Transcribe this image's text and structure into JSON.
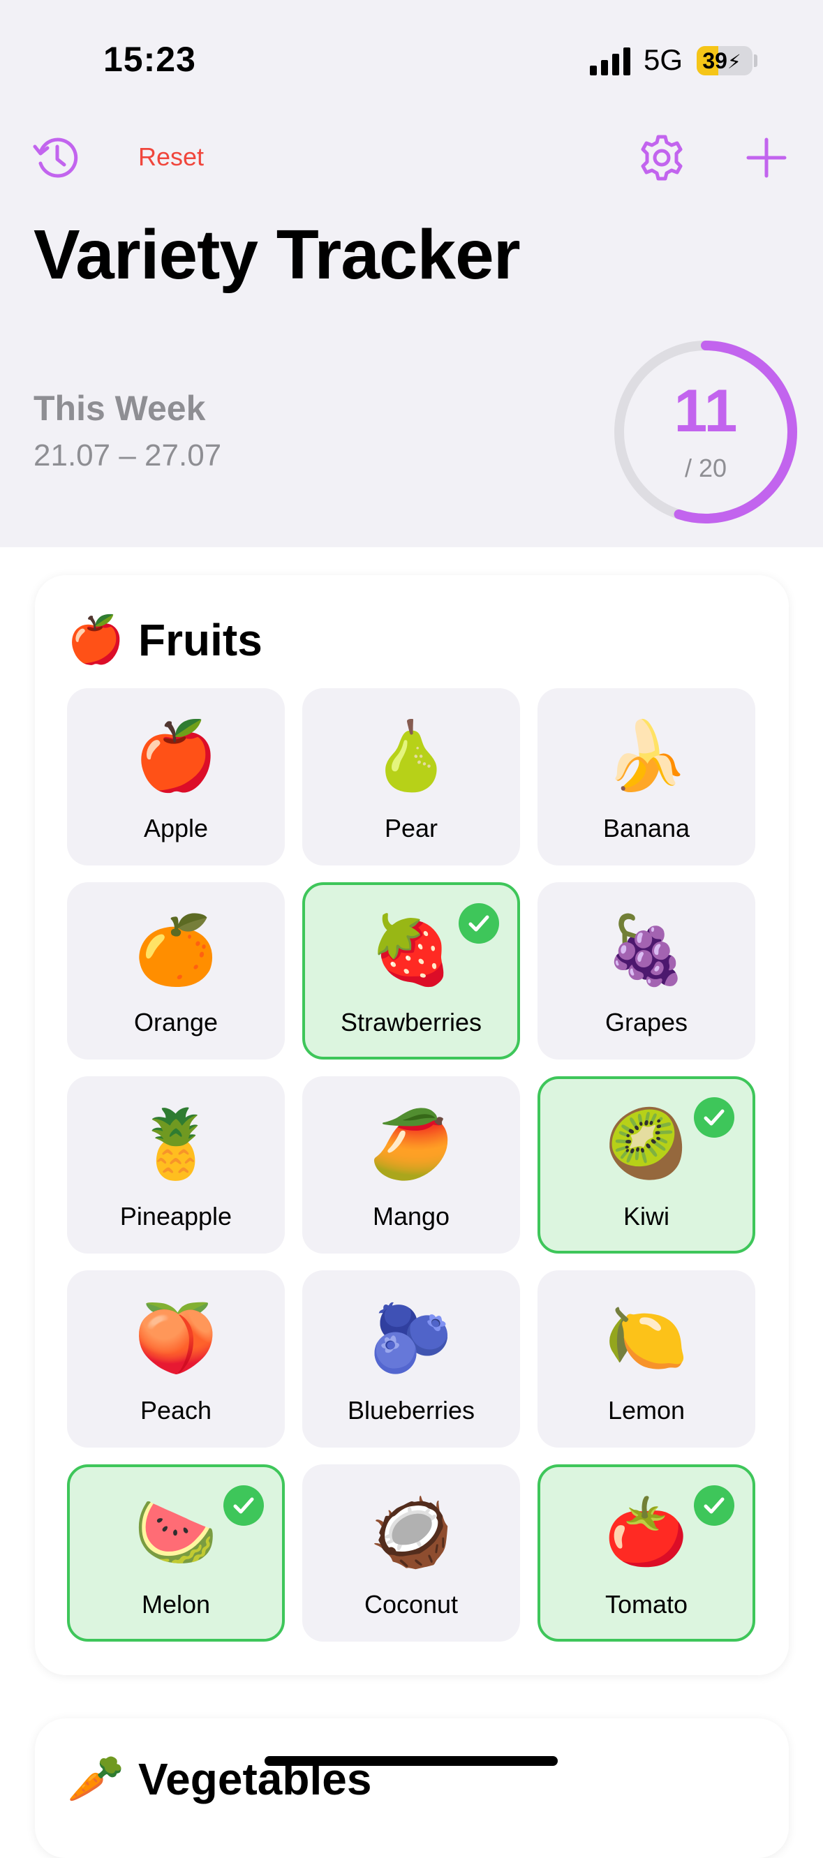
{
  "status_bar": {
    "time": "15:23",
    "network": "5G",
    "battery_percent": "39",
    "battery_level": 0.39,
    "signal_icon": "cellular-signal-icon",
    "battery_icon": "battery-charging-icon"
  },
  "header": {
    "history_icon": "history-clock-icon",
    "reset_label": "Reset",
    "settings_icon": "gear-icon",
    "add_icon": "plus-icon",
    "title": "Variety Tracker"
  },
  "week": {
    "label": "This Week",
    "range": "21.07 – 27.07"
  },
  "progress": {
    "current": 11,
    "total_label": "/ 20",
    "total": 20,
    "fraction": 0.55
  },
  "fruits": {
    "emoji": "🍎",
    "title": "Fruits",
    "items": [
      {
        "label": "Apple",
        "emoji": "🍎",
        "selected": false
      },
      {
        "label": "Pear",
        "emoji": "🍐",
        "selected": false
      },
      {
        "label": "Banana",
        "emoji": "🍌",
        "selected": false
      },
      {
        "label": "Orange",
        "emoji": "🍊",
        "selected": false
      },
      {
        "label": "Strawberries",
        "emoji": "🍓",
        "selected": true
      },
      {
        "label": "Grapes",
        "emoji": "🍇",
        "selected": false
      },
      {
        "label": "Pineapple",
        "emoji": "🍍",
        "selected": false
      },
      {
        "label": "Mango",
        "emoji": "🥭",
        "selected": false
      },
      {
        "label": "Kiwi",
        "emoji": "🥝",
        "selected": true
      },
      {
        "label": "Peach",
        "emoji": "🍑",
        "selected": false
      },
      {
        "label": "Blueberries",
        "emoji": "🫐",
        "selected": false
      },
      {
        "label": "Lemon",
        "emoji": "🍋",
        "selected": false
      },
      {
        "label": "Melon",
        "emoji": "🍉",
        "selected": true
      },
      {
        "label": "Coconut",
        "emoji": "🥥",
        "selected": false
      },
      {
        "label": "Tomato",
        "emoji": "🍅",
        "selected": true
      }
    ]
  },
  "vegetables": {
    "emoji": "🥕",
    "title": "Vegetables"
  },
  "colors": {
    "accent": "#c264ee",
    "reset": "#f0463c",
    "selected_border": "#3ec65a",
    "selected_bg": "#dcf5df",
    "tile_bg": "#f2f1f6"
  }
}
